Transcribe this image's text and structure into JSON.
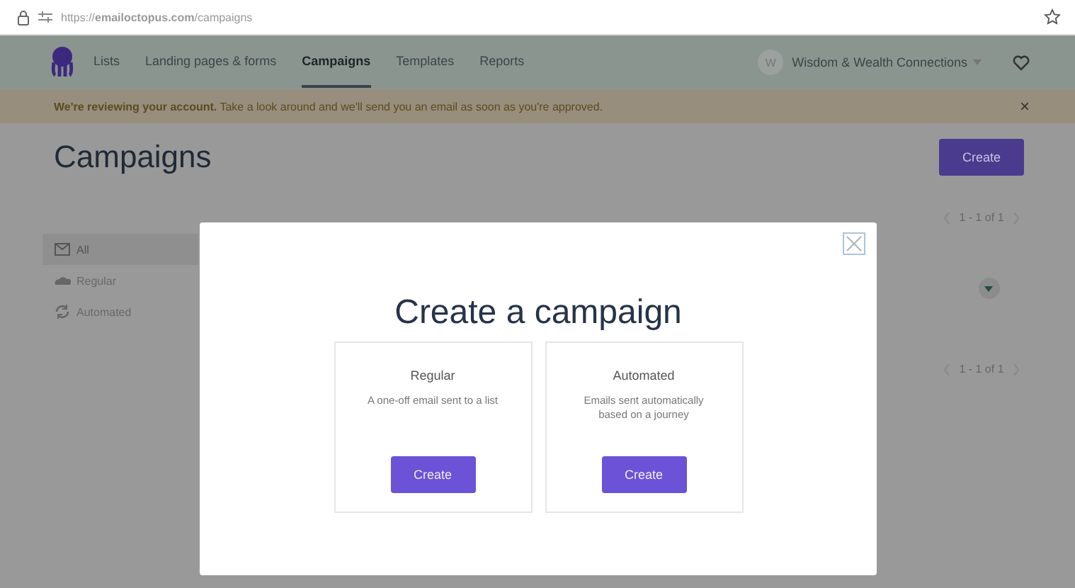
{
  "browser": {
    "url": "https://**emailoctopus.com**/campaigns"
  },
  "nav": {
    "items": [
      {
        "label": "Lists",
        "selected": false
      },
      {
        "label": "Landing pages & forms",
        "selected": false
      },
      {
        "label": "Campaigns",
        "selected": true
      },
      {
        "label": "Templates",
        "selected": false
      },
      {
        "label": "Reports",
        "selected": false
      }
    ],
    "account": {
      "initial": "W",
      "name": "Wisdom & Wealth Connections"
    }
  },
  "banner": {
    "text": "**We're reviewing your account.** Take a look around and we'll send you an email as soon as you're approved.",
    "close": "×"
  },
  "page": {
    "title": "Campaigns",
    "create": "Create",
    "filters": [
      {
        "label": "All",
        "selected": true
      },
      {
        "label": "Regular",
        "selected": false
      },
      {
        "label": "Automated",
        "selected": false
      }
    ],
    "pagination": [
      "1 - 1 of 1",
      "1 - 1 of 1"
    ]
  },
  "modal": {
    "title": "Create a campaign",
    "options": [
      {
        "name": "Regular",
        "description": "A one-off email sent to a list",
        "button": "Create"
      },
      {
        "name": "Automated",
        "description": "Emails sent automatically based on a journey",
        "button": "Create"
      }
    ]
  }
}
